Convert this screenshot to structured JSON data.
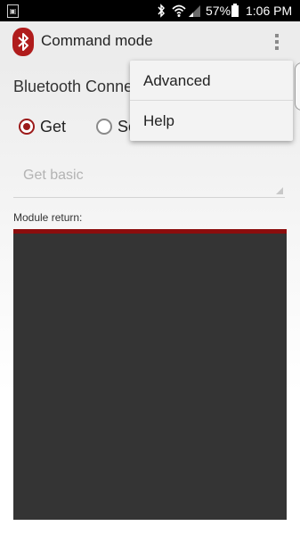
{
  "status_bar": {
    "battery": "57%",
    "time": "1:06 PM",
    "icons": [
      "screenshot-icon",
      "bluetooth-icon",
      "wifi-icon",
      "signal-icon",
      "battery-icon"
    ]
  },
  "action_bar": {
    "title": "Command mode",
    "app_icon": "bluetooth-icon",
    "overflow_icon": "more-vert-icon"
  },
  "content": {
    "section_title": "Bluetooth Conne",
    "radio_get": "Get",
    "radio_set": "Se",
    "selected_mode": "Get",
    "spinner_value": "Get basic",
    "module_label": "Module return:",
    "module_output": ""
  },
  "menu": {
    "items": [
      {
        "label": "Advanced"
      },
      {
        "label": "Help"
      }
    ]
  },
  "colors": {
    "accent": "#9c1a1a",
    "output_background": "#343434",
    "output_border": "#8b0d0d"
  }
}
